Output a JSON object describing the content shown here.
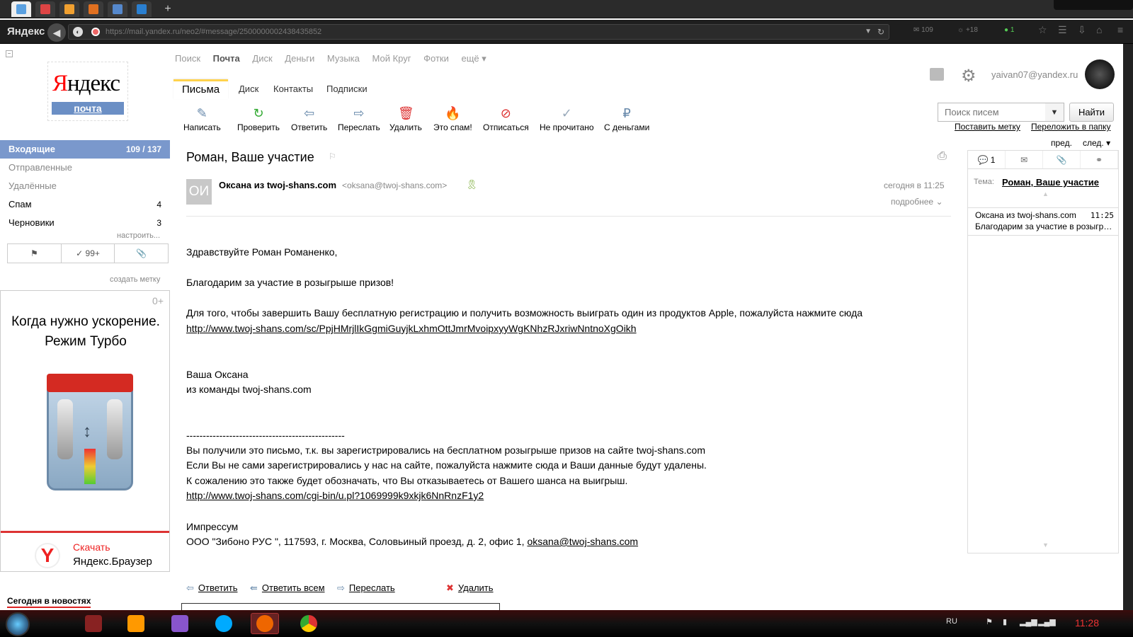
{
  "browser": {
    "tabs": [
      {
        "name": "mail-tab",
        "color": "#5aa0e0",
        "active": true
      },
      {
        "name": "gmail-tab",
        "color": "#d44"
      },
      {
        "name": "tab-3",
        "color": "#f0a030"
      },
      {
        "name": "tab-4",
        "color": "#e07020"
      },
      {
        "name": "tab-5",
        "color": "#5588cc"
      },
      {
        "name": "tab-6",
        "color": "#2a7fd0"
      }
    ],
    "new_tab": "+",
    "brand": "Яндекс",
    "url": "https://mail.yandex.ru/neo2/#message/2500000002438435852",
    "mail_count": "109",
    "weather": "+18",
    "ext_count": "1"
  },
  "logo": {
    "text_y": "Я",
    "text_rest": "ндекс",
    "sub": "почта"
  },
  "collapse": "−",
  "folders": [
    {
      "label": "Входящие",
      "count": "109 / 137",
      "active": true
    },
    {
      "label": "Отправленные",
      "count": "",
      "dim": true
    },
    {
      "label": "Удалённые",
      "count": "",
      "dim": true
    },
    {
      "label": "Спам",
      "count": "4"
    },
    {
      "label": "Черновики",
      "count": "3"
    }
  ],
  "configure": "настроить...",
  "filters": {
    "flag": "⚑",
    "done": "✓ 99+",
    "attach": "📎"
  },
  "create_label": "создать метку",
  "ad": {
    "top": "0+",
    "headline1": "Когда нужно ускорение.",
    "headline2": "Режим Турбо",
    "logo": "Y",
    "cta1": "Скачать",
    "cta2": "Яндекс.Браузер"
  },
  "news": "Сегодня в новостях",
  "topnav": [
    "Поиск",
    "Почта",
    "Диск",
    "Деньги",
    "Музыка",
    "Мой Круг",
    "Фотки",
    "ещё ▾"
  ],
  "user": {
    "email": "yaivan07@yandex.ru"
  },
  "subtabs": [
    "Письма",
    "Диск",
    "Контакты",
    "Подписки"
  ],
  "toolbar": [
    {
      "label": "Написать",
      "icon": "compose-icon"
    },
    {
      "label": "Проверить",
      "icon": "refresh-icon"
    },
    {
      "label": "Ответить",
      "icon": "reply-icon"
    },
    {
      "label": "Переслать",
      "icon": "forward-icon"
    },
    {
      "label": "Удалить",
      "icon": "trash-icon"
    },
    {
      "label": "Это спам!",
      "icon": "spam-icon"
    },
    {
      "label": "Отписаться",
      "icon": "unsubscribe-icon"
    },
    {
      "label": "Не прочитано",
      "icon": "unread-icon"
    },
    {
      "label": "С деньгами",
      "icon": "money-icon"
    }
  ],
  "search": {
    "placeholder": "Поиск писем",
    "button": "Найти",
    "dd": "▼"
  },
  "links": {
    "set_label": "Поставить метку",
    "move_to": "Переложить в папку",
    "prev": "пред.",
    "next": "след. ▾"
  },
  "message": {
    "subject": "Роман, Ваше участие",
    "avatar": "ОИ",
    "sender_name": "Оксана из twoj-shans.com",
    "sender_email": "<oksana@twoj-shans.com>",
    "date": "сегодня в 11:25",
    "details": "подробнее",
    "body": {
      "greeting": "Здравствуйте Роман Романенко,",
      "thanks": "Благодарим за участие в розыгрыше призов!",
      "instruction": "Для того, чтобы завершить Вашу бесплатную регистрацию и получить возможность выиграть один из продуктов Apple, пожалуйста нажмите сюда",
      "link1": "http://www.twoj-shans.com/sc/PpjHMrjlIkGgmiGuyjkLxhmOttJmrMvoipxyyWgKNhzRJxriwNntnoXgOikh",
      "sign1": "Ваша Оксана",
      "sign2": "из команды twoj-shans.com",
      "divider": "------------------------------------------------",
      "note1": "Вы получили это письмо, т.к. вы зарегистрировались на бесплатном розыгрыше призов на сайте twoj-shans.com",
      "note2": "Если Вы не сами зарегистрировались у нас на сайте, пожалуйста нажмите сюда и Ваши данные будут удалены.",
      "note3": "К сожалению это также  будет обозначать, что Вы отказываетесь от Вашего шанса на выигрыш.",
      "link2": "http://www.twoj-shans.com/cgi-bin/u.pl?1069999k9xkjk6NnRnzF1y2",
      "imprint": "Импрессум",
      "company": "ООО \"Зибоно РУС \", 117593, г. Москва, Соловьиный проезд, д. 2, офис 1, ",
      "company_email": "oksana@twoj-shans.com"
    },
    "actions": {
      "reply": "Ответить",
      "reply_all": "Ответить всем",
      "forward": "Переслать",
      "delete": "Удалить"
    }
  },
  "thread": {
    "tab_count": "1",
    "subject_label": "Тема:",
    "subject": "Роман, Ваше участие",
    "item_from": "Оксана из twoj-shans.com",
    "item_time": "11:25",
    "item_snippet": "Благодарим за участие в розыгрыше призов!"
  },
  "taskbar": {
    "lang": "RU",
    "clock": "11:28"
  }
}
